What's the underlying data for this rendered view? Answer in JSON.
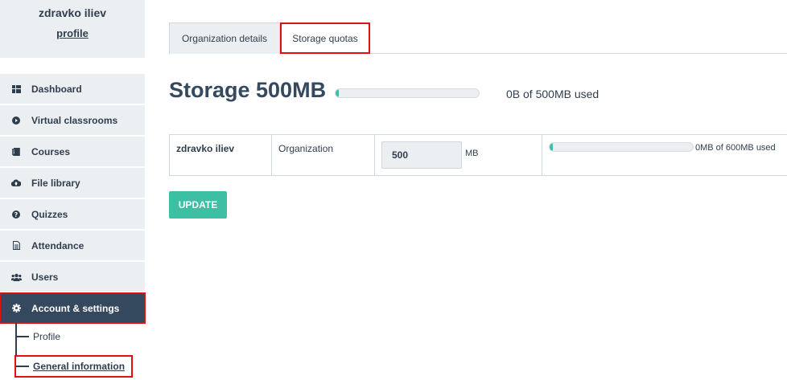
{
  "user": {
    "name": "zdravko iliev",
    "profile_link": "profile"
  },
  "sidebar": {
    "items": [
      {
        "label": "Dashboard",
        "icon": "dashboard-icon"
      },
      {
        "label": "Virtual classrooms",
        "icon": "play-icon"
      },
      {
        "label": "Courses",
        "icon": "book-icon"
      },
      {
        "label": "File library",
        "icon": "cloud-upload-icon"
      },
      {
        "label": "Quizzes",
        "icon": "question-icon"
      },
      {
        "label": "Attendance",
        "icon": "document-icon"
      },
      {
        "label": "Users",
        "icon": "users-icon"
      },
      {
        "label": "Account & settings",
        "icon": "gear-icon",
        "active": true
      }
    ],
    "subitems": [
      {
        "label": "Profile"
      },
      {
        "label": "General information",
        "current": true
      }
    ]
  },
  "tabs": [
    {
      "label": "Organization details",
      "active": false
    },
    {
      "label": "Storage quotas",
      "active": true
    }
  ],
  "storage": {
    "title": "Storage 500MB",
    "used_text": "0B of 500MB used",
    "used_fraction": 0.0
  },
  "quota_table": {
    "rows": [
      {
        "name": "zdravko iliev",
        "type": "Organization",
        "quota_value": "500",
        "quota_unit": "MB",
        "usage_text": "0MB of 600MB used",
        "usage_fraction": 0.0
      }
    ]
  },
  "actions": {
    "update_label": "UPDATE"
  },
  "colors": {
    "accent": "#3cbfa2",
    "sidebar_active": "#34495e",
    "highlight_outline": "#e01010"
  }
}
